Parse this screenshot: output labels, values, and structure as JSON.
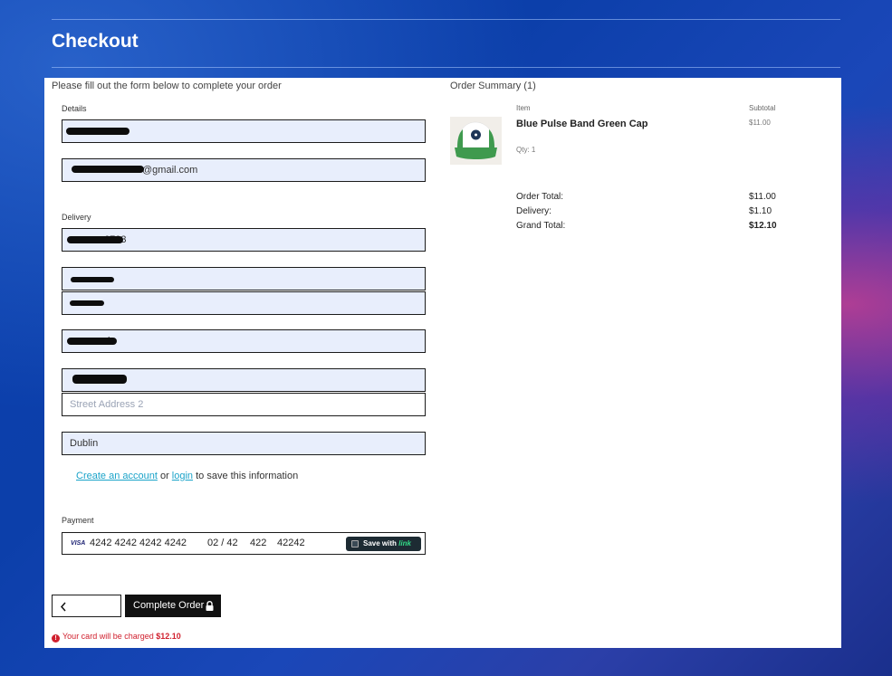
{
  "page": {
    "title": "Checkout"
  },
  "form": {
    "intro": "Please fill out the form below to complete your order",
    "details_label": "Details",
    "name_value": "",
    "email_value": "@gmail.com",
    "delivery_label": "Delivery",
    "phone_value": "6703",
    "country_value": "",
    "postcode_value": "",
    "town_value": "k",
    "street1_value": "",
    "street2_placeholder": "Street Address 2",
    "county_value": "Dublin",
    "account_link": "Create an account",
    "account_or": " or ",
    "login_link": "login",
    "account_suffix": " to save this information",
    "payment_label": "Payment"
  },
  "payment": {
    "card_brand": "VISA",
    "card_number": "4242 4242 4242 4242",
    "expiry": "02 / 42",
    "cvc": "422",
    "zip": "42242",
    "link_prefix": "Save with ",
    "link_brand": "link"
  },
  "actions": {
    "back_icon": "chevron-left-icon",
    "complete_label": "Complete Order",
    "complete_icon": "lock-icon",
    "charge_prefix": "Your card will be charged ",
    "charge_amount": "$12.10"
  },
  "summary": {
    "title": "Order Summary (1)",
    "item_header": "Item",
    "subtotal_header": "Subtotal",
    "items": [
      {
        "name": "Blue Pulse Band Green Cap",
        "qty": "Qty: 1",
        "subtotal": "$11.00"
      }
    ],
    "order_total_label": "Order Total:",
    "order_total": "$11.00",
    "delivery_label": "Delivery:",
    "delivery": "$1.10",
    "grand_total_label": "Grand Total:",
    "grand_total": "$12.10"
  },
  "colors": {
    "accent_link": "#1aa3c9",
    "error": "#d0202e",
    "field_bg": "#e8eefc",
    "button_dark": "#111111"
  }
}
